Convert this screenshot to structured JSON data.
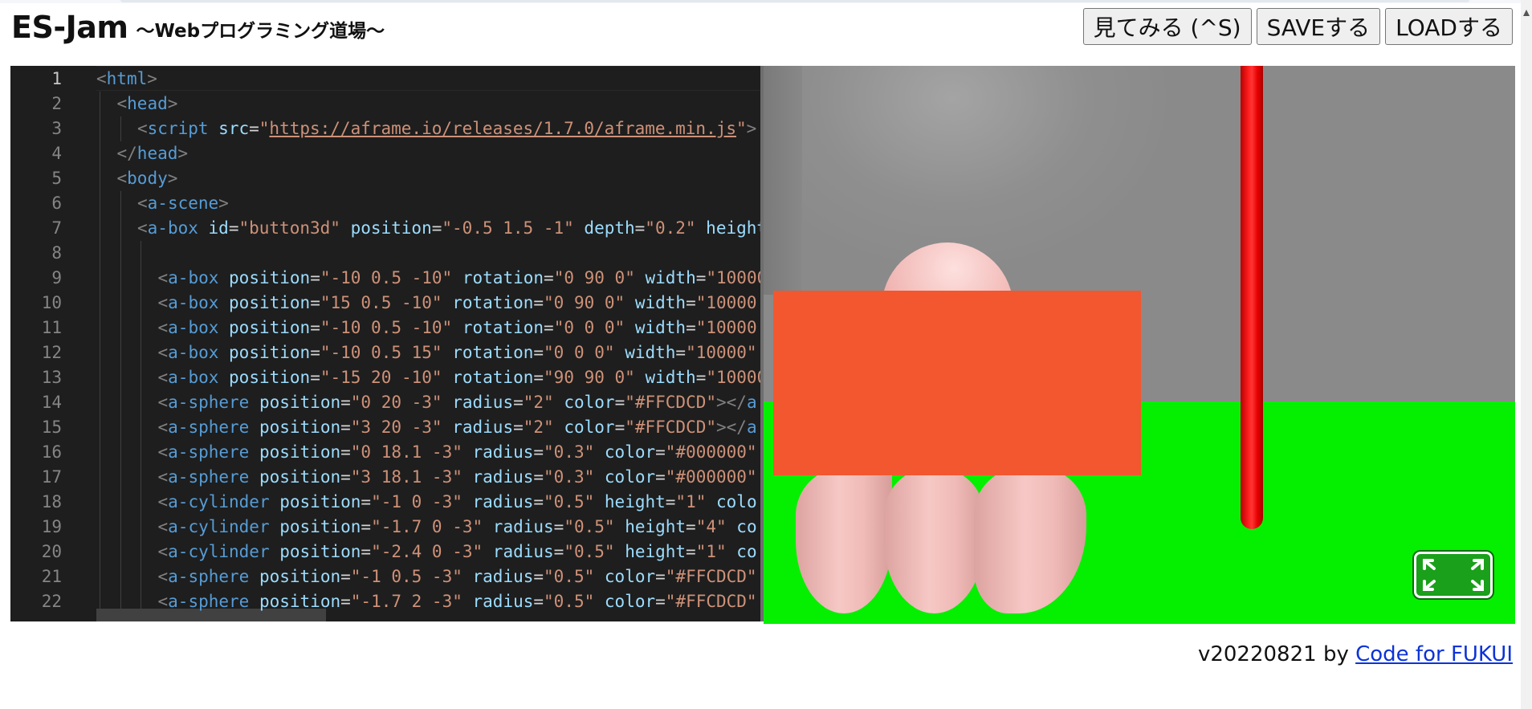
{
  "header": {
    "title": "ES-Jam",
    "subtitle": "～Webプログラミング道場～"
  },
  "toolbar": {
    "preview_label": "見てみる (^S)",
    "save_label": "SAVEする",
    "load_label": "LOADする"
  },
  "editor": {
    "active_line": 1,
    "lines": [
      {
        "n": "1",
        "indent": 0,
        "tokens": [
          [
            "br",
            "<"
          ],
          [
            "tag",
            "html"
          ],
          [
            "br",
            ">"
          ]
        ]
      },
      {
        "n": "2",
        "indent": 1,
        "tokens": [
          [
            "br",
            "<"
          ],
          [
            "tag",
            "head"
          ],
          [
            "br",
            ">"
          ]
        ]
      },
      {
        "n": "3",
        "indent": 2,
        "tokens": [
          [
            "br",
            "<"
          ],
          [
            "tag",
            "script"
          ],
          [
            "sp",
            " "
          ],
          [
            "attr",
            "src"
          ],
          [
            "eq",
            "="
          ],
          [
            "str",
            "\""
          ],
          [
            "url",
            "https://aframe.io/releases/1.7.0/aframe.min.js"
          ],
          [
            "str",
            "\""
          ],
          [
            "br",
            ">"
          ]
        ]
      },
      {
        "n": "4",
        "indent": 1,
        "tokens": [
          [
            "br",
            "</"
          ],
          [
            "tag",
            "head"
          ],
          [
            "br",
            ">"
          ]
        ]
      },
      {
        "n": "5",
        "indent": 1,
        "tokens": [
          [
            "br",
            "<"
          ],
          [
            "tag",
            "body"
          ],
          [
            "br",
            ">"
          ]
        ]
      },
      {
        "n": "6",
        "indent": 2,
        "tokens": [
          [
            "br",
            "<"
          ],
          [
            "tag",
            "a-scene"
          ],
          [
            "br",
            ">"
          ]
        ]
      },
      {
        "n": "7",
        "indent": 2,
        "tokens": [
          [
            "br",
            "<"
          ],
          [
            "tag",
            "a-box"
          ],
          [
            "sp",
            " "
          ],
          [
            "attr",
            "id"
          ],
          [
            "eq",
            "="
          ],
          [
            "str",
            "\"button3d\""
          ],
          [
            "sp",
            " "
          ],
          [
            "attr",
            "position"
          ],
          [
            "eq",
            "="
          ],
          [
            "str",
            "\"-0.5 1.5 -1\""
          ],
          [
            "sp",
            " "
          ],
          [
            "attr",
            "depth"
          ],
          [
            "eq",
            "="
          ],
          [
            "str",
            "\"0.2\""
          ],
          [
            "sp",
            " "
          ],
          [
            "attr",
            "height"
          ]
        ]
      },
      {
        "n": "8",
        "indent": 3,
        "tokens": []
      },
      {
        "n": "9",
        "indent": 3,
        "tokens": [
          [
            "br",
            "<"
          ],
          [
            "tag",
            "a-box"
          ],
          [
            "sp",
            " "
          ],
          [
            "attr",
            "position"
          ],
          [
            "eq",
            "="
          ],
          [
            "str",
            "\"-10 0.5 -10\""
          ],
          [
            "sp",
            " "
          ],
          [
            "attr",
            "rotation"
          ],
          [
            "eq",
            "="
          ],
          [
            "str",
            "\"0 90 0\""
          ],
          [
            "sp",
            " "
          ],
          [
            "attr",
            "width"
          ],
          [
            "eq",
            "="
          ],
          [
            "str",
            "\"10000"
          ]
        ]
      },
      {
        "n": "10",
        "indent": 3,
        "tokens": [
          [
            "br",
            "<"
          ],
          [
            "tag",
            "a-box"
          ],
          [
            "sp",
            " "
          ],
          [
            "attr",
            "position"
          ],
          [
            "eq",
            "="
          ],
          [
            "str",
            "\"15 0.5 -10\""
          ],
          [
            "sp",
            " "
          ],
          [
            "attr",
            "rotation"
          ],
          [
            "eq",
            "="
          ],
          [
            "str",
            "\"0 90 0\""
          ],
          [
            "sp",
            " "
          ],
          [
            "attr",
            "width"
          ],
          [
            "eq",
            "="
          ],
          [
            "str",
            "\"10000"
          ]
        ]
      },
      {
        "n": "11",
        "indent": 3,
        "tokens": [
          [
            "br",
            "<"
          ],
          [
            "tag",
            "a-box"
          ],
          [
            "sp",
            " "
          ],
          [
            "attr",
            "position"
          ],
          [
            "eq",
            "="
          ],
          [
            "str",
            "\"-10 0.5 -10\""
          ],
          [
            "sp",
            " "
          ],
          [
            "attr",
            "rotation"
          ],
          [
            "eq",
            "="
          ],
          [
            "str",
            "\"0 0 0\""
          ],
          [
            "sp",
            " "
          ],
          [
            "attr",
            "width"
          ],
          [
            "eq",
            "="
          ],
          [
            "str",
            "\"10000"
          ]
        ]
      },
      {
        "n": "12",
        "indent": 3,
        "tokens": [
          [
            "br",
            "<"
          ],
          [
            "tag",
            "a-box"
          ],
          [
            "sp",
            " "
          ],
          [
            "attr",
            "position"
          ],
          [
            "eq",
            "="
          ],
          [
            "str",
            "\"-10 0.5 15\""
          ],
          [
            "sp",
            " "
          ],
          [
            "attr",
            "rotation"
          ],
          [
            "eq",
            "="
          ],
          [
            "str",
            "\"0 0 0\""
          ],
          [
            "sp",
            " "
          ],
          [
            "attr",
            "width"
          ],
          [
            "eq",
            "="
          ],
          [
            "str",
            "\"10000\""
          ]
        ]
      },
      {
        "n": "13",
        "indent": 3,
        "tokens": [
          [
            "br",
            "<"
          ],
          [
            "tag",
            "a-box"
          ],
          [
            "sp",
            " "
          ],
          [
            "attr",
            "position"
          ],
          [
            "eq",
            "="
          ],
          [
            "str",
            "\"-15 20 -10\""
          ],
          [
            "sp",
            " "
          ],
          [
            "attr",
            "rotation"
          ],
          [
            "eq",
            "="
          ],
          [
            "str",
            "\"90 90 0\""
          ],
          [
            "sp",
            " "
          ],
          [
            "attr",
            "width"
          ],
          [
            "eq",
            "="
          ],
          [
            "str",
            "\"10000"
          ]
        ]
      },
      {
        "n": "14",
        "indent": 3,
        "tokens": [
          [
            "br",
            "<"
          ],
          [
            "tag",
            "a-sphere"
          ],
          [
            "sp",
            " "
          ],
          [
            "attr",
            "position"
          ],
          [
            "eq",
            "="
          ],
          [
            "str",
            "\"0 20 -3\""
          ],
          [
            "sp",
            " "
          ],
          [
            "attr",
            "radius"
          ],
          [
            "eq",
            "="
          ],
          [
            "str",
            "\"2\""
          ],
          [
            "sp",
            " "
          ],
          [
            "attr",
            "color"
          ],
          [
            "eq",
            "="
          ],
          [
            "str",
            "\"#FFCDCD\""
          ],
          [
            "br",
            "></"
          ],
          [
            "tag",
            "a"
          ]
        ]
      },
      {
        "n": "15",
        "indent": 3,
        "tokens": [
          [
            "br",
            "<"
          ],
          [
            "tag",
            "a-sphere"
          ],
          [
            "sp",
            " "
          ],
          [
            "attr",
            "position"
          ],
          [
            "eq",
            "="
          ],
          [
            "str",
            "\"3 20 -3\""
          ],
          [
            "sp",
            " "
          ],
          [
            "attr",
            "radius"
          ],
          [
            "eq",
            "="
          ],
          [
            "str",
            "\"2\""
          ],
          [
            "sp",
            " "
          ],
          [
            "attr",
            "color"
          ],
          [
            "eq",
            "="
          ],
          [
            "str",
            "\"#FFCDCD\""
          ],
          [
            "br",
            "></"
          ],
          [
            "tag",
            "a"
          ]
        ]
      },
      {
        "n": "16",
        "indent": 3,
        "tokens": [
          [
            "br",
            "<"
          ],
          [
            "tag",
            "a-sphere"
          ],
          [
            "sp",
            " "
          ],
          [
            "attr",
            "position"
          ],
          [
            "eq",
            "="
          ],
          [
            "str",
            "\"0 18.1 -3\""
          ],
          [
            "sp",
            " "
          ],
          [
            "attr",
            "radius"
          ],
          [
            "eq",
            "="
          ],
          [
            "str",
            "\"0.3\""
          ],
          [
            "sp",
            " "
          ],
          [
            "attr",
            "color"
          ],
          [
            "eq",
            "="
          ],
          [
            "str",
            "\"#000000\""
          ]
        ]
      },
      {
        "n": "17",
        "indent": 3,
        "tokens": [
          [
            "br",
            "<"
          ],
          [
            "tag",
            "a-sphere"
          ],
          [
            "sp",
            " "
          ],
          [
            "attr",
            "position"
          ],
          [
            "eq",
            "="
          ],
          [
            "str",
            "\"3 18.1 -3\""
          ],
          [
            "sp",
            " "
          ],
          [
            "attr",
            "radius"
          ],
          [
            "eq",
            "="
          ],
          [
            "str",
            "\"0.3\""
          ],
          [
            "sp",
            " "
          ],
          [
            "attr",
            "color"
          ],
          [
            "eq",
            "="
          ],
          [
            "str",
            "\"#000000\""
          ]
        ]
      },
      {
        "n": "18",
        "indent": 3,
        "tokens": [
          [
            "br",
            "<"
          ],
          [
            "tag",
            "a-cylinder"
          ],
          [
            "sp",
            " "
          ],
          [
            "attr",
            "position"
          ],
          [
            "eq",
            "="
          ],
          [
            "str",
            "\"-1 0 -3\""
          ],
          [
            "sp",
            " "
          ],
          [
            "attr",
            "radius"
          ],
          [
            "eq",
            "="
          ],
          [
            "str",
            "\"0.5\""
          ],
          [
            "sp",
            " "
          ],
          [
            "attr",
            "height"
          ],
          [
            "eq",
            "="
          ],
          [
            "str",
            "\"1\""
          ],
          [
            "sp",
            " "
          ],
          [
            "attr",
            "colo"
          ]
        ]
      },
      {
        "n": "19",
        "indent": 3,
        "tokens": [
          [
            "br",
            "<"
          ],
          [
            "tag",
            "a-cylinder"
          ],
          [
            "sp",
            " "
          ],
          [
            "attr",
            "position"
          ],
          [
            "eq",
            "="
          ],
          [
            "str",
            "\"-1.7 0 -3\""
          ],
          [
            "sp",
            " "
          ],
          [
            "attr",
            "radius"
          ],
          [
            "eq",
            "="
          ],
          [
            "str",
            "\"0.5\""
          ],
          [
            "sp",
            " "
          ],
          [
            "attr",
            "height"
          ],
          [
            "eq",
            "="
          ],
          [
            "str",
            "\"4\""
          ],
          [
            "sp",
            " "
          ],
          [
            "attr",
            "co"
          ]
        ]
      },
      {
        "n": "20",
        "indent": 3,
        "tokens": [
          [
            "br",
            "<"
          ],
          [
            "tag",
            "a-cylinder"
          ],
          [
            "sp",
            " "
          ],
          [
            "attr",
            "position"
          ],
          [
            "eq",
            "="
          ],
          [
            "str",
            "\"-2.4 0 -3\""
          ],
          [
            "sp",
            " "
          ],
          [
            "attr",
            "radius"
          ],
          [
            "eq",
            "="
          ],
          [
            "str",
            "\"0.5\""
          ],
          [
            "sp",
            " "
          ],
          [
            "attr",
            "height"
          ],
          [
            "eq",
            "="
          ],
          [
            "str",
            "\"1\""
          ],
          [
            "sp",
            " "
          ],
          [
            "attr",
            "co"
          ]
        ]
      },
      {
        "n": "21",
        "indent": 3,
        "tokens": [
          [
            "br",
            "<"
          ],
          [
            "tag",
            "a-sphere"
          ],
          [
            "sp",
            " "
          ],
          [
            "attr",
            "position"
          ],
          [
            "eq",
            "="
          ],
          [
            "str",
            "\"-1 0.5 -3\""
          ],
          [
            "sp",
            " "
          ],
          [
            "attr",
            "radius"
          ],
          [
            "eq",
            "="
          ],
          [
            "str",
            "\"0.5\""
          ],
          [
            "sp",
            " "
          ],
          [
            "attr",
            "color"
          ],
          [
            "eq",
            "="
          ],
          [
            "str",
            "\"#FFCDCD\""
          ]
        ]
      },
      {
        "n": "22",
        "indent": 3,
        "tokens": [
          [
            "br",
            "<"
          ],
          [
            "tag",
            "a-sphere"
          ],
          [
            "sp",
            " "
          ],
          [
            "attr",
            "position"
          ],
          [
            "eq",
            "="
          ],
          [
            "str",
            "\"-1.7 2 -3\""
          ],
          [
            "sp",
            " "
          ],
          [
            "attr",
            "radius"
          ],
          [
            "eq",
            "="
          ],
          [
            "str",
            "\"0.5\""
          ],
          [
            "sp",
            " "
          ],
          [
            "attr",
            "color"
          ],
          [
            "eq",
            "="
          ],
          [
            "str",
            "\"#FFCDCD\""
          ]
        ]
      }
    ]
  },
  "scene": {
    "colors": {
      "wall": "#8f8f8f",
      "ground": "#04f000",
      "pink": "#FFCDCD",
      "orange_panel": "#f2572f",
      "red_pole": "#ff1e1e"
    },
    "vr_button_icon": "fullscreen-expand-icon"
  },
  "footer": {
    "version_text": "v20220821 by ",
    "link_text": "Code for FUKUI"
  }
}
